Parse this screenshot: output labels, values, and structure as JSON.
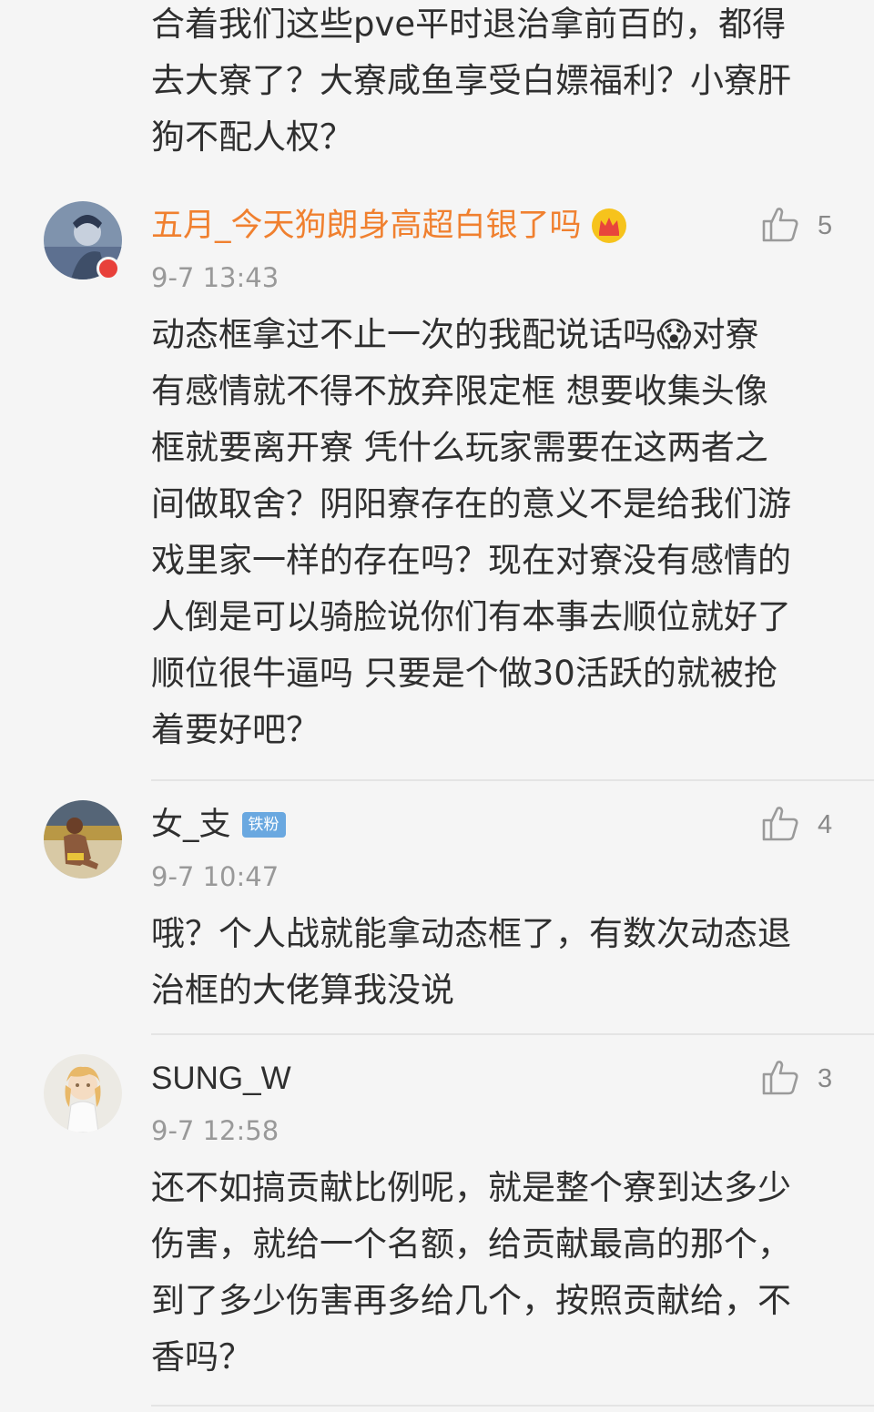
{
  "comments": [
    {
      "body": "合着我们这些pve平时退治拿前百的，都得\n去大寮了？大寮咸鱼享受白嫖福利？小寮肝\n狗不配人权？"
    },
    {
      "username": "五月_今天狗朗身高超白银了吗",
      "user_badge_icon": "crown-icon",
      "timestamp": "9-7 13:43",
      "likes": "5",
      "body": "动态框拿过不止一次的我配说话吗😱对寮\n有感情就不得不放弃限定框 想要收集头像\n框就要离开寮 凭什么玩家需要在这两者之\n间做取舍？阴阳寮存在的意义不是给我们游\n戏里家一样的存在吗？现在对寮没有感情的\n人倒是可以骑脸说你们有本事去顺位就好了\n顺位很牛逼吗 只要是个做30活跃的就被抢\n着要好吧？"
    },
    {
      "username": "女_支",
      "badge": "铁粉",
      "timestamp": "9-7 10:47",
      "likes": "4",
      "body": "哦？个人战就能拿动态框了，有数次动态退\n治框的大佬算我没说"
    },
    {
      "username": "SUNG_W",
      "timestamp": "9-7 12:58",
      "likes": "3",
      "body": "还不如搞贡献比例呢，就是整个寮到达多少\n伤害，就给一个名额，给贡献最高的那个，\n到了多少伤害再多给几个，按照贡献给，不\n香吗？"
    }
  ],
  "colors": {
    "background": "#f5f5f5",
    "username_highlight": "#f0802f",
    "timestamp": "#999999",
    "fan_badge": "#6aa8e0"
  }
}
